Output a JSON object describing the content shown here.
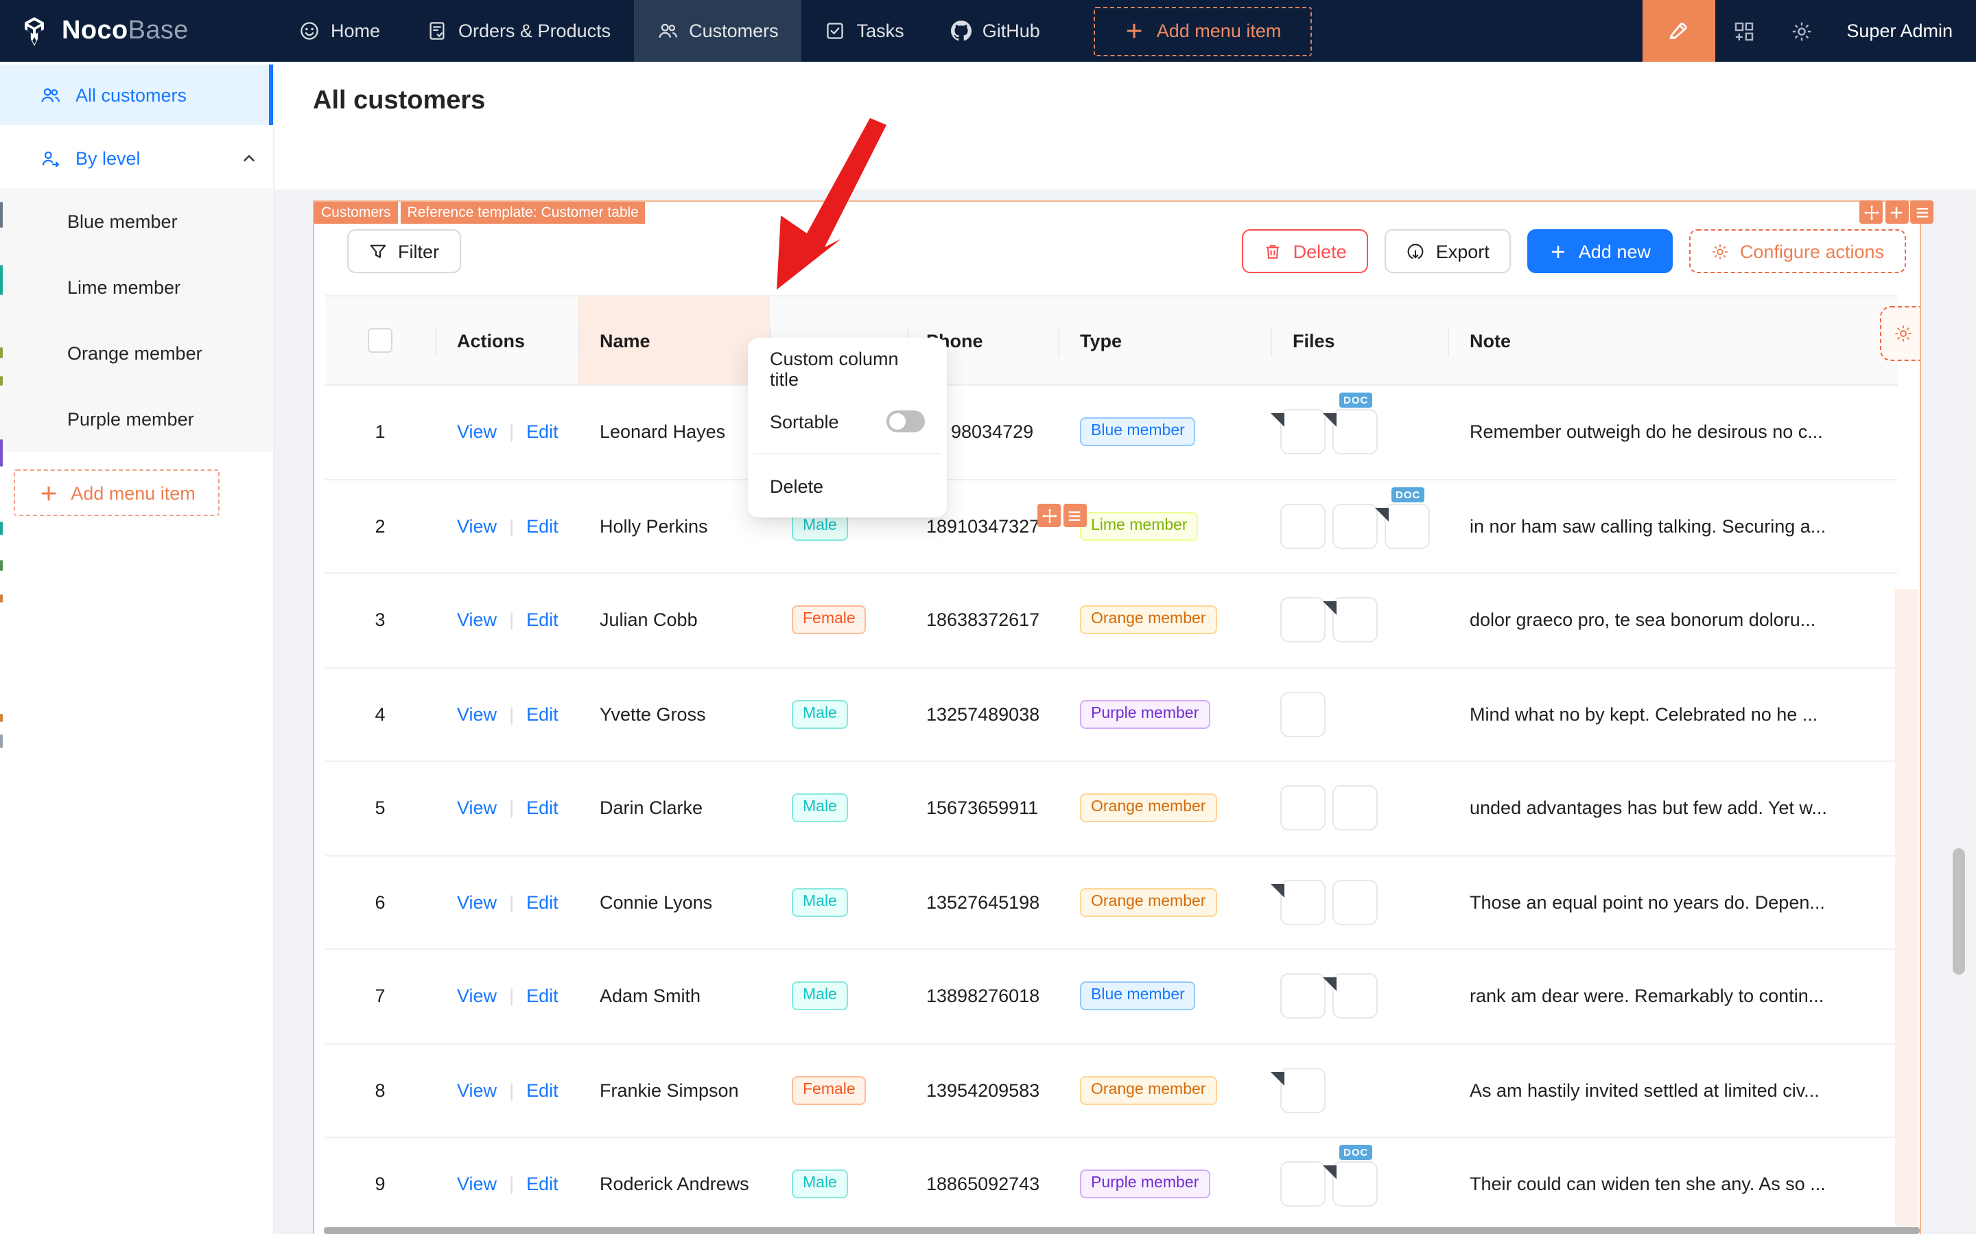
{
  "topbar": {
    "brand": {
      "bold": "Noco",
      "light": "Base",
      "logo_icon": "nocobase-cube-icon"
    },
    "nav": [
      {
        "label": "Home",
        "icon": "smiley-icon",
        "active": false
      },
      {
        "label": "Orders & Products",
        "icon": "orders-icon",
        "active": false
      },
      {
        "label": "Customers",
        "icon": "customers-icon",
        "active": true
      },
      {
        "label": "Tasks",
        "icon": "tasks-icon",
        "active": false
      },
      {
        "label": "GitHub",
        "icon": "github-icon",
        "active": false
      }
    ],
    "add_menu_item": "Add menu item",
    "user": "Super Admin"
  },
  "sidebar": {
    "items": [
      {
        "label": "All customers",
        "icon": "team-icon",
        "selected": true,
        "expandable": false
      },
      {
        "label": "By level",
        "icon": "user-switch-icon",
        "selected": false,
        "expandable": true
      }
    ],
    "sub_items": [
      "Blue member",
      "Lime member",
      "Orange member",
      "Purple member"
    ],
    "add_menu_item": "Add menu item"
  },
  "page": {
    "title": "All customers"
  },
  "block": {
    "labels": [
      "Customers",
      "Reference template: Customer table"
    ],
    "toolbar": {
      "filter": "Filter",
      "delete": "Delete",
      "export": "Export",
      "add_new": "Add new",
      "configure_actions": "Configure actions"
    }
  },
  "column_menu": {
    "custom_title": "Custom column title",
    "sortable": "Sortable",
    "sortable_on": false,
    "delete_item": "Delete"
  },
  "table": {
    "action_labels": [
      "View",
      "Edit"
    ],
    "headers": [
      {
        "key": "sel",
        "label": ""
      },
      {
        "key": "actions",
        "label": "Actions"
      },
      {
        "key": "name",
        "label": "Name",
        "highlight": true
      },
      {
        "key": "gender",
        "label": ""
      },
      {
        "key": "phone",
        "label": "Phone"
      },
      {
        "key": "type",
        "label": "Type"
      },
      {
        "key": "files",
        "label": "Files"
      },
      {
        "key": "note",
        "label": "Note"
      }
    ],
    "rows": [
      {
        "n": "1",
        "name": "Leonard Hayes",
        "gender": "",
        "phone": "98034729",
        "phone_offset": true,
        "type": "Blue member",
        "files": [
          "pdf",
          "doc"
        ],
        "note": "Remember outweigh do he desirous no c..."
      },
      {
        "n": "2",
        "name": "Holly Perkins",
        "gender": "Male",
        "phone": "18910347327",
        "phone_offset": false,
        "type": "Lime member",
        "files": [
          "img-oranges",
          "img-grapes",
          "doc"
        ],
        "note": "in nor ham saw calling talking. Securing a..."
      },
      {
        "n": "3",
        "name": "Julian Cobb",
        "gender": "Female",
        "phone": "18638372617",
        "phone_offset": false,
        "type": "Orange member",
        "files": [
          "img-food",
          "pdf"
        ],
        "note": "dolor graeco pro, te sea bonorum doloru..."
      },
      {
        "n": "4",
        "name": "Yvette Gross",
        "gender": "Male",
        "phone": "13257489038",
        "phone_offset": false,
        "type": "Purple member",
        "files": [
          "img-trays"
        ],
        "note": "Mind what no by kept. Celebrated no he ..."
      },
      {
        "n": "5",
        "name": "Darin Clarke",
        "gender": "Male",
        "phone": "15673659911",
        "phone_offset": false,
        "type": "Orange member",
        "files": [
          "img-citrus",
          "img-trays"
        ],
        "note": "unded advantages has but few add. Yet w..."
      },
      {
        "n": "6",
        "name": "Connie Lyons",
        "gender": "Male",
        "phone": "13527645198",
        "phone_offset": false,
        "type": "Orange member",
        "files": [
          "pdf",
          "img-oranges"
        ],
        "note": "Those an equal point no years do. Depen..."
      },
      {
        "n": "7",
        "name": "Adam Smith",
        "gender": "Male",
        "phone": "13898276018",
        "phone_offset": false,
        "type": "Blue member",
        "files": [
          "img-coffee",
          "pdf"
        ],
        "note": "rank am dear were. Remarkably to contin..."
      },
      {
        "n": "8",
        "name": "Frankie Simpson",
        "gender": "Female",
        "phone": "13954209583",
        "phone_offset": false,
        "type": "Orange member",
        "files": [
          "pdf"
        ],
        "note": "As am hastily invited settled at limited civ..."
      },
      {
        "n": "9",
        "name": "Roderick Andrews",
        "gender": "Male",
        "phone": "18865092743",
        "phone_offset": false,
        "type": "Purple member",
        "files": [
          "img-storefront",
          "doc"
        ],
        "note": "Their could can widen ten she any. As so ..."
      }
    ]
  },
  "tag_colors": {
    "Male": {
      "bg": "#e6fffb",
      "border": "#87e8de",
      "text": "#13c2c2"
    },
    "Female": {
      "bg": "#fff2e8",
      "border": "#ffbb96",
      "text": "#fa541c"
    },
    "Blue member": {
      "bg": "#e6f4ff",
      "border": "#91caff",
      "text": "#1677ff"
    },
    "Lime member": {
      "bg": "#fcffe6",
      "border": "#eaff8f",
      "text": "#7cb305"
    },
    "Orange member": {
      "bg": "#fff7e6",
      "border": "#ffd591",
      "text": "#d46b08"
    },
    "Purple member": {
      "bg": "#f9f0ff",
      "border": "#d3adf7",
      "text": "#722ed1"
    }
  },
  "misc": {
    "doc_badge": "DOC",
    "accent_orange": "#f18b62",
    "primary_blue": "#1677ff",
    "danger_red": "#ff4d4f",
    "topbar_bg": "#0c1e3a",
    "arrow_red": "#e81c1c"
  }
}
